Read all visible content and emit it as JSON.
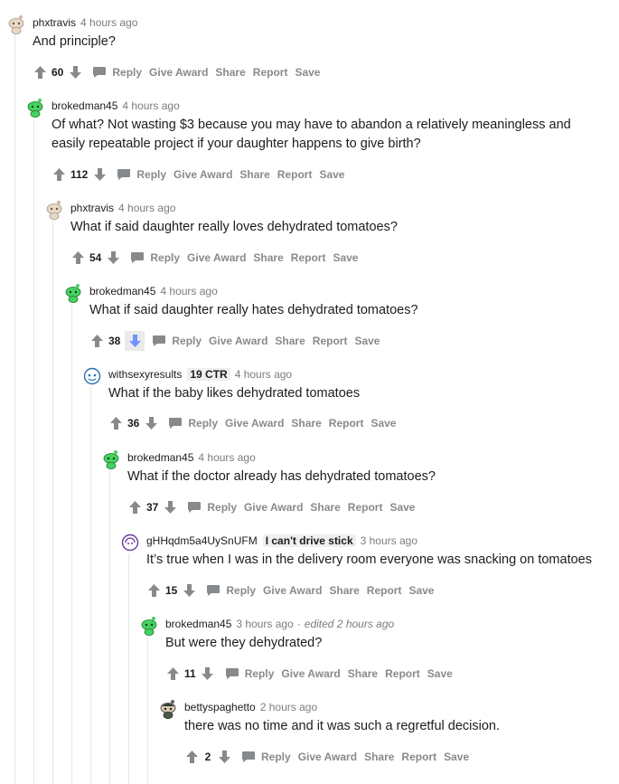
{
  "colors": {
    "vote_gray": "#878a8c",
    "downvote_active": "#7193ff",
    "thread_line": "#e6e6e6",
    "text": "#1c1c1c",
    "meta": "#7c7c7c",
    "flair_bg": "#edeff1"
  },
  "actions": {
    "reply": "Reply",
    "give_award": "Give Award",
    "share": "Share",
    "report": "Report",
    "save": "Save"
  },
  "comments": [
    {
      "author": "phxtravis",
      "avatar": "snoo-beige",
      "time": "4 hours ago",
      "body": "And principle?",
      "score": "60"
    },
    {
      "author": "brokedman45",
      "avatar": "snoo-green",
      "time": "4 hours ago",
      "body": "Of what? Not wasting $3 because you may have to abandon a relatively meaningless and easily repeatable project if your daughter happens to give birth?",
      "score": "112"
    },
    {
      "author": "phxtravis",
      "avatar": "snoo-beige",
      "time": "4 hours ago",
      "body": "What if said daughter really loves dehydrated tomatoes?",
      "score": "54"
    },
    {
      "author": "brokedman45",
      "avatar": "snoo-green",
      "time": "4 hours ago",
      "body": "What if said daughter really hates dehydrated tomatoes?",
      "score": "38",
      "downvoted": true
    },
    {
      "author": "withsexyresults",
      "flair": "19 CTR",
      "avatar": "snoo-blue",
      "time": "4 hours ago",
      "body": "What if the baby likes dehydrated tomatoes",
      "score": "36"
    },
    {
      "author": "brokedman45",
      "avatar": "snoo-green",
      "time": "4 hours ago",
      "body": "What if the doctor already has dehydrated tomatoes?",
      "score": "37"
    },
    {
      "author": "gHHqdm5a4UySnUFM",
      "flair": "I can't drive stick",
      "avatar": "snoo-purple",
      "time": "3 hours ago",
      "body": "It’s true when I was in the delivery room everyone was snacking on tomatoes",
      "score": "15"
    },
    {
      "author": "brokedman45",
      "avatar": "snoo-green",
      "time": "3 hours ago",
      "edited": "edited 2 hours ago",
      "body": "But were they dehydrated?",
      "score": "11"
    },
    {
      "author": "bettyspaghetto",
      "avatar": "snoo-dark",
      "time": "2 hours ago",
      "body": "there was no time and it was such a regretful decision.",
      "score": "2"
    }
  ]
}
